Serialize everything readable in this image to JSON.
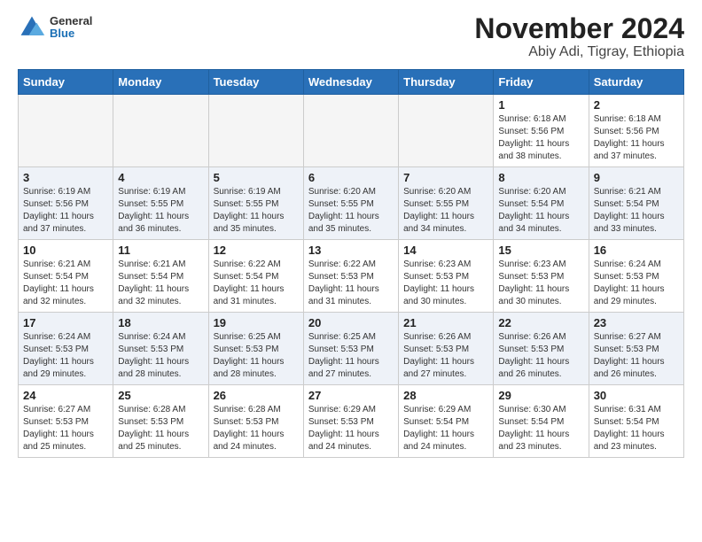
{
  "header": {
    "logo_line1": "General",
    "logo_line2": "Blue",
    "title": "November 2024",
    "subtitle": "Abiy Adi, Tigray, Ethiopia"
  },
  "days_of_week": [
    "Sunday",
    "Monday",
    "Tuesday",
    "Wednesday",
    "Thursday",
    "Friday",
    "Saturday"
  ],
  "weeks": [
    [
      {
        "day": "",
        "empty": true
      },
      {
        "day": "",
        "empty": true
      },
      {
        "day": "",
        "empty": true
      },
      {
        "day": "",
        "empty": true
      },
      {
        "day": "",
        "empty": true
      },
      {
        "day": "1",
        "sunrise": "6:18 AM",
        "sunset": "5:56 PM",
        "daylight": "11 hours and 38 minutes."
      },
      {
        "day": "2",
        "sunrise": "6:18 AM",
        "sunset": "5:56 PM",
        "daylight": "11 hours and 37 minutes."
      }
    ],
    [
      {
        "day": "3",
        "sunrise": "6:19 AM",
        "sunset": "5:56 PM",
        "daylight": "11 hours and 37 minutes."
      },
      {
        "day": "4",
        "sunrise": "6:19 AM",
        "sunset": "5:55 PM",
        "daylight": "11 hours and 36 minutes."
      },
      {
        "day": "5",
        "sunrise": "6:19 AM",
        "sunset": "5:55 PM",
        "daylight": "11 hours and 35 minutes."
      },
      {
        "day": "6",
        "sunrise": "6:20 AM",
        "sunset": "5:55 PM",
        "daylight": "11 hours and 35 minutes."
      },
      {
        "day": "7",
        "sunrise": "6:20 AM",
        "sunset": "5:55 PM",
        "daylight": "11 hours and 34 minutes."
      },
      {
        "day": "8",
        "sunrise": "6:20 AM",
        "sunset": "5:54 PM",
        "daylight": "11 hours and 34 minutes."
      },
      {
        "day": "9",
        "sunrise": "6:21 AM",
        "sunset": "5:54 PM",
        "daylight": "11 hours and 33 minutes."
      }
    ],
    [
      {
        "day": "10",
        "sunrise": "6:21 AM",
        "sunset": "5:54 PM",
        "daylight": "11 hours and 32 minutes."
      },
      {
        "day": "11",
        "sunrise": "6:21 AM",
        "sunset": "5:54 PM",
        "daylight": "11 hours and 32 minutes."
      },
      {
        "day": "12",
        "sunrise": "6:22 AM",
        "sunset": "5:54 PM",
        "daylight": "11 hours and 31 minutes."
      },
      {
        "day": "13",
        "sunrise": "6:22 AM",
        "sunset": "5:53 PM",
        "daylight": "11 hours and 31 minutes."
      },
      {
        "day": "14",
        "sunrise": "6:23 AM",
        "sunset": "5:53 PM",
        "daylight": "11 hours and 30 minutes."
      },
      {
        "day": "15",
        "sunrise": "6:23 AM",
        "sunset": "5:53 PM",
        "daylight": "11 hours and 30 minutes."
      },
      {
        "day": "16",
        "sunrise": "6:24 AM",
        "sunset": "5:53 PM",
        "daylight": "11 hours and 29 minutes."
      }
    ],
    [
      {
        "day": "17",
        "sunrise": "6:24 AM",
        "sunset": "5:53 PM",
        "daylight": "11 hours and 29 minutes."
      },
      {
        "day": "18",
        "sunrise": "6:24 AM",
        "sunset": "5:53 PM",
        "daylight": "11 hours and 28 minutes."
      },
      {
        "day": "19",
        "sunrise": "6:25 AM",
        "sunset": "5:53 PM",
        "daylight": "11 hours and 28 minutes."
      },
      {
        "day": "20",
        "sunrise": "6:25 AM",
        "sunset": "5:53 PM",
        "daylight": "11 hours and 27 minutes."
      },
      {
        "day": "21",
        "sunrise": "6:26 AM",
        "sunset": "5:53 PM",
        "daylight": "11 hours and 27 minutes."
      },
      {
        "day": "22",
        "sunrise": "6:26 AM",
        "sunset": "5:53 PM",
        "daylight": "11 hours and 26 minutes."
      },
      {
        "day": "23",
        "sunrise": "6:27 AM",
        "sunset": "5:53 PM",
        "daylight": "11 hours and 26 minutes."
      }
    ],
    [
      {
        "day": "24",
        "sunrise": "6:27 AM",
        "sunset": "5:53 PM",
        "daylight": "11 hours and 25 minutes."
      },
      {
        "day": "25",
        "sunrise": "6:28 AM",
        "sunset": "5:53 PM",
        "daylight": "11 hours and 25 minutes."
      },
      {
        "day": "26",
        "sunrise": "6:28 AM",
        "sunset": "5:53 PM",
        "daylight": "11 hours and 24 minutes."
      },
      {
        "day": "27",
        "sunrise": "6:29 AM",
        "sunset": "5:53 PM",
        "daylight": "11 hours and 24 minutes."
      },
      {
        "day": "28",
        "sunrise": "6:29 AM",
        "sunset": "5:54 PM",
        "daylight": "11 hours and 24 minutes."
      },
      {
        "day": "29",
        "sunrise": "6:30 AM",
        "sunset": "5:54 PM",
        "daylight": "11 hours and 23 minutes."
      },
      {
        "day": "30",
        "sunrise": "6:31 AM",
        "sunset": "5:54 PM",
        "daylight": "11 hours and 23 minutes."
      }
    ]
  ],
  "labels": {
    "sunrise": "Sunrise:",
    "sunset": "Sunset:",
    "daylight": "Daylight:"
  }
}
